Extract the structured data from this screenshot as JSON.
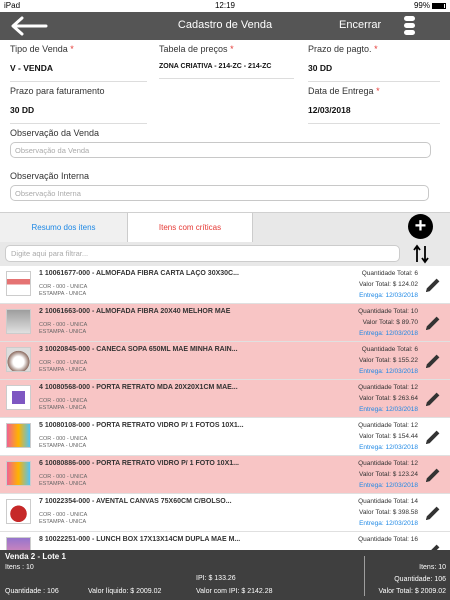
{
  "status": {
    "device": "iPad",
    "time": "12:19",
    "battery": "99%"
  },
  "nav": {
    "title": "Cadastro de Venda",
    "encerrar": "Encerrar"
  },
  "form": {
    "tipo_venda": {
      "label": "Tipo de Venda",
      "required_mark": "*",
      "value": "V - VENDA"
    },
    "tabela_precos": {
      "label": "Tabela de preços",
      "required_mark": "*",
      "value": "ZONA CRIATIVA - 214-ZC - 214-ZC"
    },
    "prazo_pagto": {
      "label": "Prazo de pagto.",
      "required_mark": "*",
      "value": "30 DD"
    },
    "prazo_faturamento": {
      "label": "Prazo para faturamento",
      "value": "30 DD"
    },
    "data_entrega": {
      "label": "Data de Entrega",
      "required_mark": "*",
      "value": "12/03/2018"
    },
    "obs_venda": {
      "label": "Observação da Venda",
      "placeholder": "Observação da Venda"
    },
    "obs_interna": {
      "label": "Observação Interna",
      "placeholder": "Observação Interna"
    }
  },
  "tabs": {
    "resumo": "Resumo dos itens",
    "criticas": "Itens com críticas"
  },
  "filter": {
    "placeholder": "Digite aqui para filtrar..."
  },
  "items": [
    {
      "name": "1 10061677-000 - ALMOFADA FIBRA CARTA LAÇO 30X30C...",
      "cor": "COR - 000 - UNICA",
      "estampa": "ESTAMPA - UNICA",
      "qty": "Quantidade Total: 6",
      "total": "Valor Total: $ 124.02",
      "entrega": "Entrega: 12/03/2018",
      "critical": false,
      "thumb": "pillow"
    },
    {
      "name": "2 10061663-000 - ALMOFADA FIBRA 20X40 MELHOR MAE",
      "cor": "COR - 000 - UNICA",
      "estampa": "ESTAMPA - UNICA",
      "qty": "Quantidade Total: 10",
      "total": "Valor Total: $ 89.70",
      "entrega": "Entrega: 12/03/2018",
      "critical": true,
      "thumb": "pillow2"
    },
    {
      "name": "3 10020845-000 - CANECA SOPA 650ML MÃE MINHA RAIN...",
      "cor": "COR - 000 - UNICA",
      "estampa": "ESTAMPA - UNICA",
      "qty": "Quantidade Total: 6",
      "total": "Valor Total: $ 155.22",
      "entrega": "Entrega: 12/03/2018",
      "critical": true,
      "thumb": "mug"
    },
    {
      "name": "4 10080568-000 - PORTA RETRATO MDA 20X20X1CM MAE...",
      "cor": "COR - 000 - UNICA",
      "estampa": "ESTAMPA - UNICA",
      "qty": "Quantidade Total: 12",
      "total": "Valor Total: $ 263.64",
      "entrega": "Entrega: 12/03/2018",
      "critical": true,
      "thumb": "frame"
    },
    {
      "name": "5 10080108-000 - PORTA RETRATO VIDRO P/ 1 FOTOS 10X1...",
      "cor": "COR - 000 - UNICA",
      "estampa": "ESTAMPA - UNICA",
      "qty": "Quantidade Total: 12",
      "total": "Valor Total: $ 154.44",
      "entrega": "Entrega: 12/03/2018",
      "critical": false,
      "thumb": "photo"
    },
    {
      "name": "6 10080886-000 - PORTA RETRATO VIDRO P/ 1 FOTO 10X1...",
      "cor": "COR - 000 - UNICA",
      "estampa": "ESTAMPA - UNICA",
      "qty": "Quantidade Total: 12",
      "total": "Valor Total: $ 123.24",
      "entrega": "Entrega: 12/03/2018",
      "critical": true,
      "thumb": "photo"
    },
    {
      "name": "7 10022354-000 - AVENTAL CANVAS 75X60CM C/BOLSO...",
      "cor": "COR - 000 - UNICA",
      "estampa": "ESTAMPA - UNICA",
      "qty": "Quantidade Total: 14",
      "total": "Valor Total: $ 398.58",
      "entrega": "Entrega: 12/03/2018",
      "critical": false,
      "thumb": "apron"
    },
    {
      "name": "8 10022251-000 - LUNCH BOX 17X13X14CM DUPLA MÃE M...",
      "cor": "COR - 000 - UNICA",
      "estampa": "ESTAMPA - UNICA",
      "qty": "Quantidade Total: 16",
      "total": "",
      "entrega": "",
      "critical": false,
      "thumb": "box"
    }
  ],
  "footer": {
    "title": "Venda 2  - Lote 1",
    "itens_left": "Itens : 10",
    "quantidade_left": "Quantidade : 106",
    "valor_liquido": "Valor líquido: $ 2009.02",
    "ipi": "IPI: $ 133.26",
    "valor_com_ipi": "Valor com IPI: $ 2142.28",
    "itens_right": "Itens: 10",
    "quantidade_right": "Quantidade: 106",
    "valor_total_right": "Valor Total: $ 2009.02"
  },
  "colors": {
    "navbar": "#555555",
    "critical_row": "#f8c5c5",
    "accent_blue": "#1e88e5",
    "accent_red": "#e53935",
    "footer": "#3f3f3f"
  }
}
